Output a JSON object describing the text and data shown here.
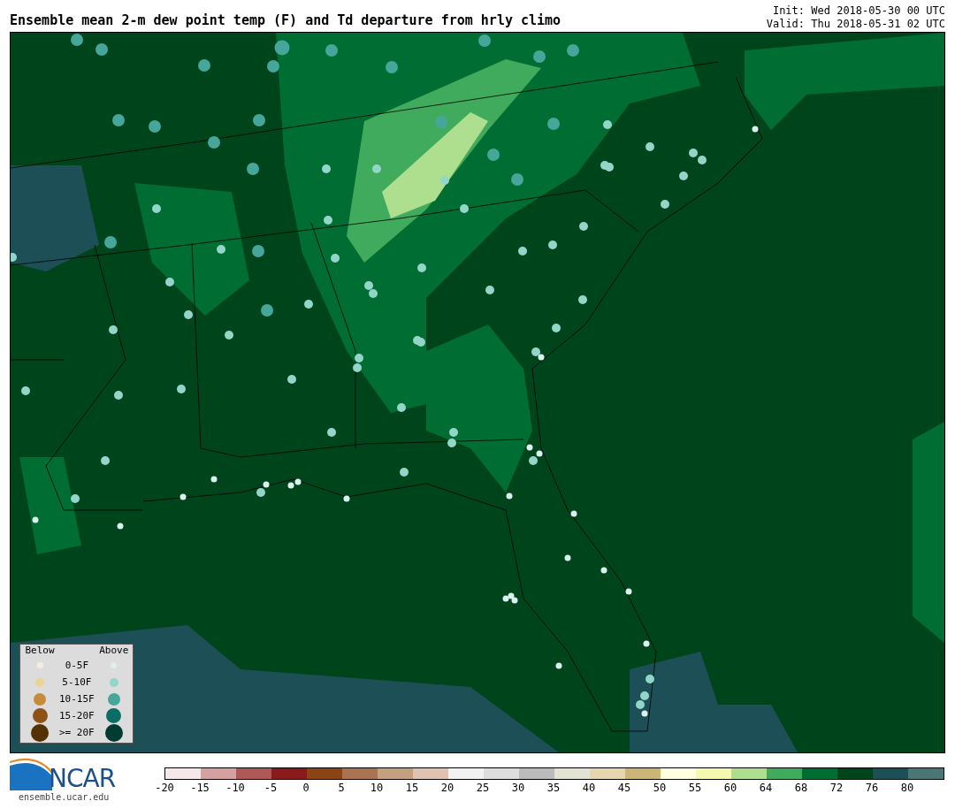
{
  "title": "Ensemble mean 2-m dew point temp (F) and Td departure from hrly climo",
  "init": "Init: Wed 2018-05-30 00 UTC",
  "valid": "Valid: Thu 2018-05-31 02 UTC",
  "legend": {
    "below_header": "Below",
    "above_header": "Above",
    "rows": [
      {
        "label": "0-5F",
        "below": {
          "color": "#f7ecd9"
        },
        "above": {
          "color": "#dbf1ef"
        }
      },
      {
        "label": "5-10F",
        "below": {
          "color": "#ecd294"
        },
        "above": {
          "color": "#92d6c9"
        }
      },
      {
        "label": "10-15F",
        "below": {
          "color": "#c68c3c"
        },
        "above": {
          "color": "#45a699"
        }
      },
      {
        "label": "15-20F",
        "below": {
          "color": "#8f5214"
        },
        "above": {
          "color": "#0b6e64"
        }
      },
      {
        "label": ">= 20F",
        "below": {
          "color": "#543005"
        },
        "above": {
          "color": "#003c30"
        }
      }
    ]
  },
  "logo": {
    "name": "NCAR",
    "url": "ensemble.ucar.edu"
  },
  "colorbar": {
    "segments": [
      {
        "color": "#f6e8e8"
      },
      {
        "color": "#d4a0a0"
      },
      {
        "color": "#b05858"
      },
      {
        "color": "#8b1a1a"
      },
      {
        "color": "#8b4513"
      },
      {
        "color": "#a87452"
      },
      {
        "color": "#c4a080"
      },
      {
        "color": "#dfc3b0"
      },
      {
        "color": "#f2f2f2"
      },
      {
        "color": "#dddddd"
      },
      {
        "color": "#bbbbbb"
      },
      {
        "color": "#e3e3d3"
      },
      {
        "color": "#e6d7ae"
      },
      {
        "color": "#cbb577"
      },
      {
        "color": "#ffffe0"
      },
      {
        "color": "#f5f9b0"
      },
      {
        "color": "#addf8e"
      },
      {
        "color": "#41ab5d"
      },
      {
        "color": "#006d32"
      },
      {
        "color": "#00441b"
      },
      {
        "color": "#1d4f57"
      },
      {
        "color": "#4a7676"
      }
    ],
    "ticks": [
      "-20",
      "-15",
      "-10",
      "-5",
      "0",
      "5",
      "10",
      "15",
      "20",
      "25",
      "30",
      "35",
      "40",
      "45",
      "50",
      "55",
      "60",
      "64",
      "68",
      "72",
      "76",
      "80"
    ]
  }
}
